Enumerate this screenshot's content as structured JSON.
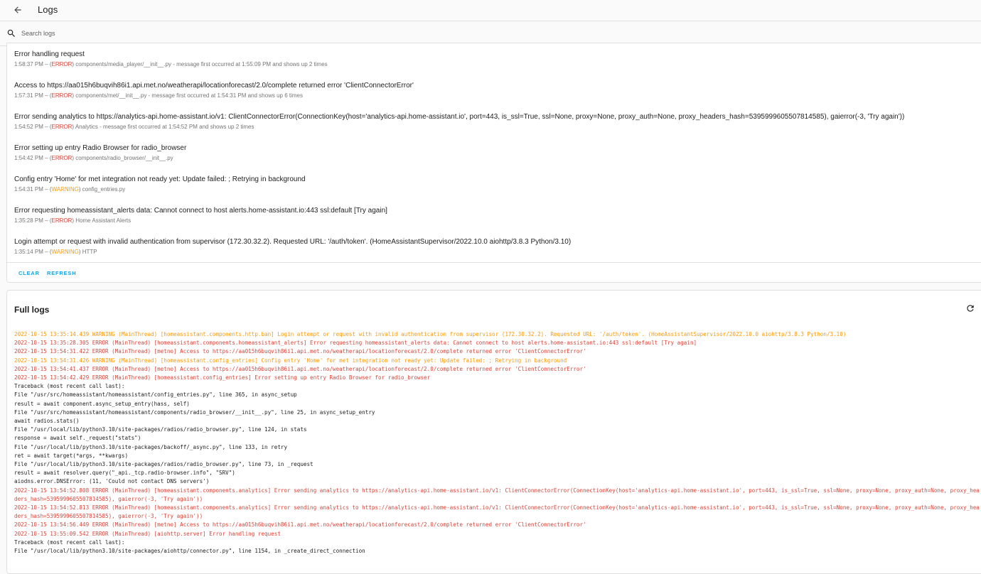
{
  "header": {
    "title": "Logs"
  },
  "search": {
    "placeholder": "Search logs"
  },
  "entries": [
    {
      "message": "Error handling request",
      "time": "1:58:37 PM",
      "level": "ERROR",
      "source": "components/media_player/__init__.py - message first occurred at 1:55:09 PM and shows up 2 times"
    },
    {
      "message": "Access to https://aa015h6buqvih86i1.api.met.no/weatherapi/locationforecast/2.0/complete returned error 'ClientConnectorError'",
      "time": "1:57:31 PM",
      "level": "ERROR",
      "source": "components/met/__init__.py - message first occurred at 1:54:31 PM and shows up 6 times"
    },
    {
      "message": "Error sending analytics to https://analytics-api.home-assistant.io/v1: ClientConnectorError(ConnectionKey(host='analytics-api.home-assistant.io', port=443, is_ssl=True, ssl=None, proxy=None, proxy_auth=None, proxy_headers_hash=5395999605507814585), gaierror(-3, 'Try again'))",
      "time": "1:54:52 PM",
      "level": "ERROR",
      "source": "Analytics - message first occurred at 1:54:52 PM and shows up 2 times"
    },
    {
      "message": "Error setting up entry Radio Browser for radio_browser",
      "time": "1:54:42 PM",
      "level": "ERROR",
      "source": "components/radio_browser/__init__.py"
    },
    {
      "message": "Config entry 'Home' for met integration not ready yet: Update failed: ; Retrying in background",
      "time": "1:54:31 PM",
      "level": "WARNING",
      "source": "config_entries.py"
    },
    {
      "message": "Error requesting homeassistant_alerts data: Cannot connect to host alerts.home-assistant.io:443 ssl:default [Try again]",
      "time": "1:35:28 PM",
      "level": "ERROR",
      "source": "Home Assistant Alerts"
    },
    {
      "message": "Login attempt or request with invalid authentication from supervisor (172.30.32.2). Requested URL: '/auth/token'. (HomeAssistantSupervisor/2022.10.0 aiohttp/3.8.3 Python/3.10)",
      "time": "1:35:14 PM",
      "level": "WARNING",
      "source": "HTTP"
    }
  ],
  "actions": {
    "clear": "CLEAR",
    "refresh": "REFRESH"
  },
  "full_logs": {
    "title": "Full logs",
    "lines": [
      {
        "level": "warning",
        "text": "2022-10-15 13:35:14.439 WARNING (MainThread) [homeassistant.components.http.ban] Login attempt or request with invalid authentication from supervisor (172.30.32.2). Requested URL: '/auth/token'. (HomeAssistantSupervisor/2022.10.0 aiohttp/3.8.3 Python/3.10)"
      },
      {
        "level": "error",
        "text": "2022-10-15 13:35:28.305 ERROR (MainThread) [homeassistant.components.homeassistant_alerts] Error requesting homeassistant_alerts data: Cannot connect to host alerts.home-assistant.io:443 ssl:default [Try again]"
      },
      {
        "level": "error",
        "text": "2022-10-15 13:54:31.422 ERROR (MainThread) [metno] Access to https://aa015h6buqvih86i1.api.met.no/weatherapi/locationforecast/2.0/complete returned error 'ClientConnectorError'"
      },
      {
        "level": "warning",
        "text": "2022-10-15 13:54:31.426 WARNING (MainThread) [homeassistant.config_entries] Config entry 'Home' for met integration not ready yet: Update failed: ; Retrying in background"
      },
      {
        "level": "error",
        "text": "2022-10-15 13:54:41.437 ERROR (MainThread) [metno] Access to https://aa015h6buqvih86i1.api.met.no/weatherapi/locationforecast/2.0/complete returned error 'ClientConnectorError'"
      },
      {
        "level": "error",
        "text": "2022-10-15 13:54:42.429 ERROR (MainThread) [homeassistant.config_entries] Error setting up entry Radio Browser for radio_browser"
      },
      {
        "level": "normal",
        "text": "Traceback (most recent call last):"
      },
      {
        "level": "normal",
        "text": "File \"/usr/src/homeassistant/homeassistant/config_entries.py\", line 365, in async_setup"
      },
      {
        "level": "normal",
        "text": "result = await component.async_setup_entry(hass, self)"
      },
      {
        "level": "normal",
        "text": "File \"/usr/src/homeassistant/homeassistant/components/radio_browser/__init__.py\", line 25, in async_setup_entry"
      },
      {
        "level": "normal",
        "text": "await radios.stats()"
      },
      {
        "level": "normal",
        "text": "File \"/usr/local/lib/python3.10/site-packages/radios/radio_browser.py\", line 124, in stats"
      },
      {
        "level": "normal",
        "text": "response = await self._request(\"stats\")"
      },
      {
        "level": "normal",
        "text": "File \"/usr/local/lib/python3.10/site-packages/backoff/_async.py\", line 133, in retry"
      },
      {
        "level": "normal",
        "text": "ret = await target(*args, **kwargs)"
      },
      {
        "level": "normal",
        "text": "File \"/usr/local/lib/python3.10/site-packages/radios/radio_browser.py\", line 73, in _request"
      },
      {
        "level": "normal",
        "text": "result = await resolver.query(\"_api._tcp.radio-browser.info\", \"SRV\")"
      },
      {
        "level": "normal",
        "text": "aiodns.error.DNSError: (11, 'Could not contact DNS servers')"
      },
      {
        "level": "error",
        "text": "2022-10-15 13:54:52.808 ERROR (MainThread) [homeassistant.components.analytics] Error sending analytics to https://analytics-api.home-assistant.io/v1: ClientConnectorError(ConnectionKey(host='analytics-api.home-assistant.io', port=443, is_ssl=True, ssl=None, proxy=None, proxy_auth=None, proxy_headers_hash=5395999605507814585), gaierror(-3, 'Try again'))"
      },
      {
        "level": "error",
        "text": "2022-10-15 13:54:52.813 ERROR (MainThread) [homeassistant.components.analytics] Error sending analytics to https://analytics-api.home-assistant.io/v1: ClientConnectorError(ConnectionKey(host='analytics-api.home-assistant.io', port=443, is_ssl=True, ssl=None, proxy=None, proxy_auth=None, proxy_headers_hash=5395999605507814585), gaierror(-3, 'Try again'))"
      },
      {
        "level": "error",
        "text": "2022-10-15 13:54:56.449 ERROR (MainThread) [metno] Access to https://aa015h6buqvih86i1.api.met.no/weatherapi/locationforecast/2.0/complete returned error 'ClientConnectorError'"
      },
      {
        "level": "error",
        "text": "2022-10-15 13:55:09.542 ERROR (MainThread) [aiohttp.server] Error handling request"
      },
      {
        "level": "normal",
        "text": "Traceback (most recent call last):"
      },
      {
        "level": "normal",
        "text": "File \"/usr/local/lib/python3.10/site-packages/aiohttp/connector.py\", line 1154, in _create_direct_connection"
      }
    ]
  },
  "colors": {
    "error": "#db4437",
    "warning": "#ff9800",
    "accent": "#03a9f4"
  },
  "icons": {
    "back": "arrow-left-icon",
    "search": "magnify-icon",
    "refresh": "refresh-icon"
  }
}
